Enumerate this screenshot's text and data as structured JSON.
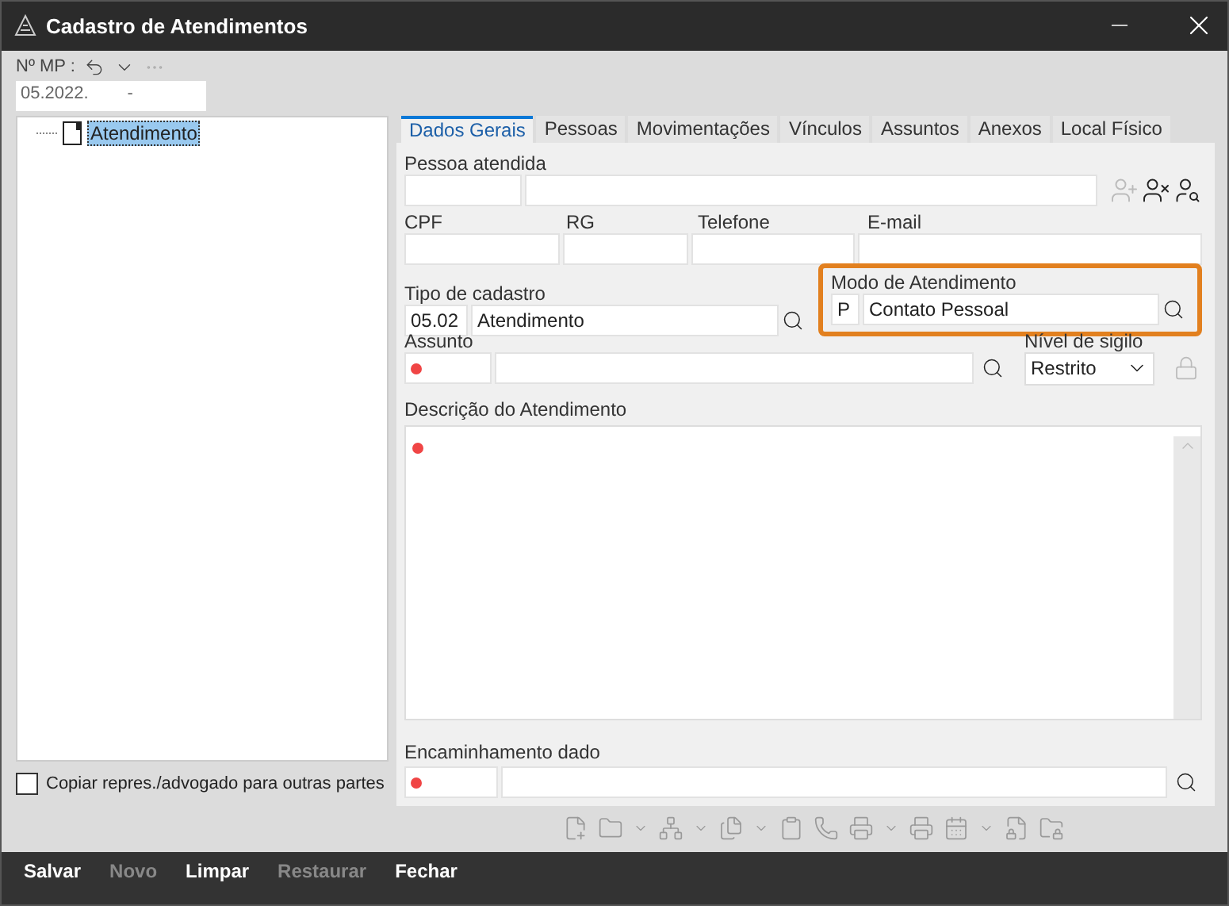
{
  "window": {
    "title": "Cadastro de Atendimentos"
  },
  "mp": {
    "label": "Nº MP :",
    "value": "05.2022.        -"
  },
  "tree": {
    "items": [
      {
        "label": "Atendimento",
        "selected": true
      }
    ]
  },
  "copy_option": {
    "label": "Copiar repres./advogado para outras partes",
    "checked": false
  },
  "tabs": [
    {
      "label": "Dados Gerais",
      "selected": true
    },
    {
      "label": "Pessoas",
      "selected": false
    },
    {
      "label": "Movimentações",
      "selected": false
    },
    {
      "label": "Vínculos",
      "selected": false
    },
    {
      "label": "Assuntos",
      "selected": false
    },
    {
      "label": "Anexos",
      "selected": false
    },
    {
      "label": "Local Físico",
      "selected": false
    }
  ],
  "pessoa": {
    "label": "Pessoa atendida"
  },
  "contact_labels": [
    "CPF",
    "RG",
    "Telefone",
    "E-mail"
  ],
  "tipo": {
    "label": "Tipo de cadastro",
    "code": "05.02",
    "value": "Atendimento"
  },
  "modo": {
    "label": "Modo de Atendimento",
    "code": "P",
    "value": "Contato Pessoal",
    "highlighted": true
  },
  "assunto": {
    "label": "Assunto",
    "required": true
  },
  "sigilo": {
    "label": "Nível de sigilo",
    "value": "Restrito"
  },
  "descricao": {
    "label": "Descrição do Atendimento",
    "required": true
  },
  "encaminhamento": {
    "label": "Encaminhamento dado",
    "required": true
  },
  "actions": [
    {
      "label": "Salvar",
      "disabled": false
    },
    {
      "label": "Novo",
      "disabled": true
    },
    {
      "label": "Limpar",
      "disabled": false
    },
    {
      "label": "Restaurar",
      "disabled": true
    },
    {
      "label": "Fechar",
      "disabled": false
    }
  ]
}
